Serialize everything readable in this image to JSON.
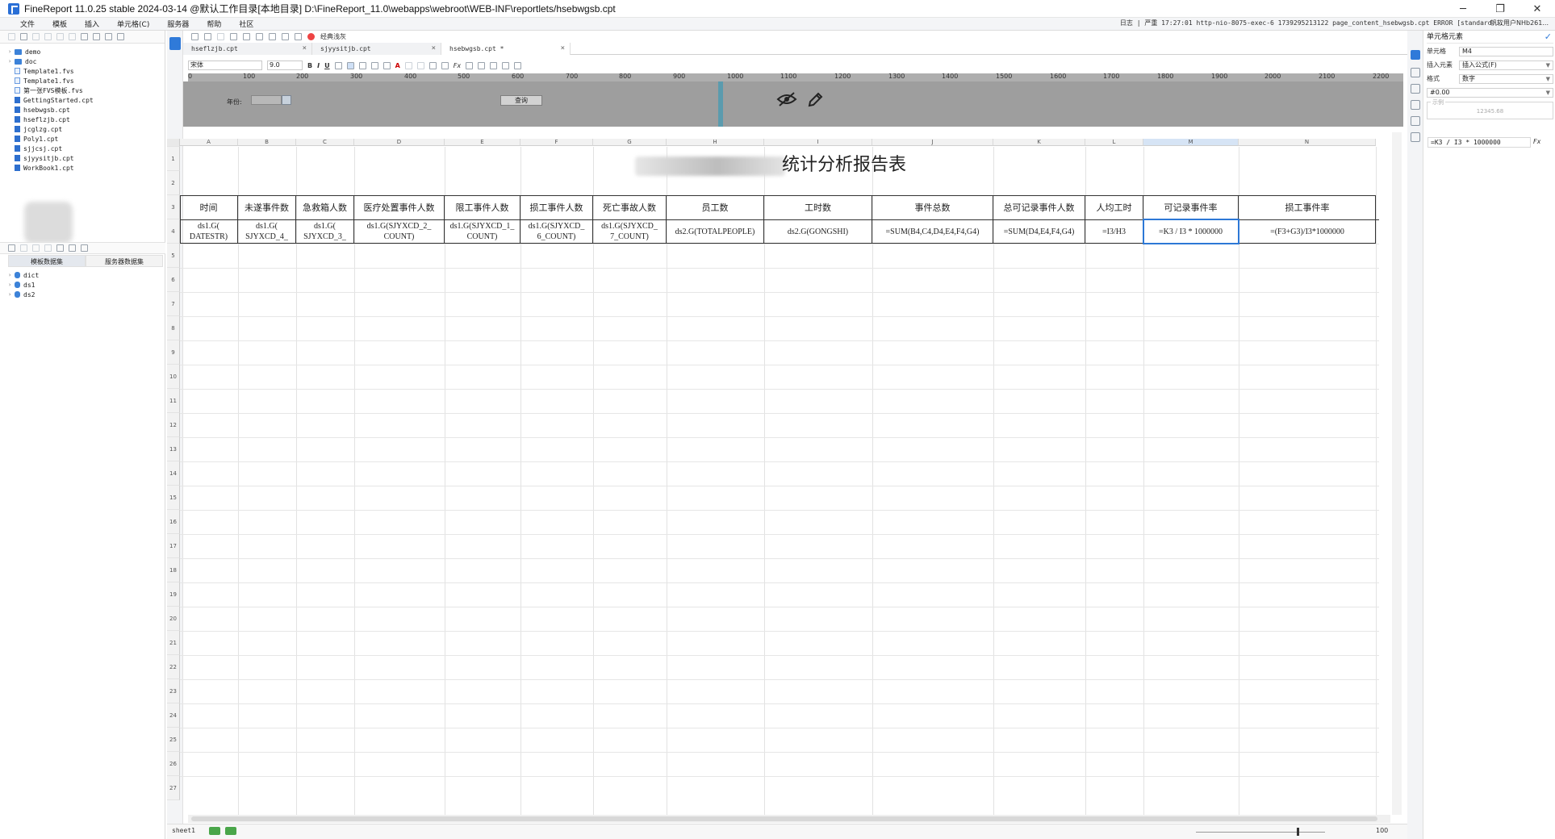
{
  "window": {
    "title": "FineReport 11.0.25 stable 2024-03-14 @默认工作目录[本地目录]    D:\\FineReport_11.0\\webapps\\webroot\\WEB-INF\\reportlets/hsebwgsb.cpt",
    "minimize": "─",
    "restore": "❐",
    "close": "✕"
  },
  "menu": {
    "items": [
      "文件",
      "模板",
      "插入",
      "单元格(C)",
      "服务器",
      "帮助",
      "社区"
    ],
    "log_text": "日志 | 严重 17:27:01 http-nio-8075-exec-6 1739295213122 page_content_hsebwgsb.cpt ERROR [standard...",
    "user": "帆软用户NHb261..."
  },
  "file_tree": [
    {
      "name": "demo",
      "type": "folder"
    },
    {
      "name": "doc",
      "type": "folder"
    },
    {
      "name": "Template1.fvs",
      "type": "file"
    },
    {
      "name": "Template1.fvs",
      "type": "file"
    },
    {
      "name": "第一张FVS模板.fvs",
      "type": "file"
    },
    {
      "name": "GettingStarted.cpt",
      "type": "cpt"
    },
    {
      "name": "hsebwgsb.cpt",
      "type": "cpt"
    },
    {
      "name": "hseflzjb.cpt",
      "type": "cpt"
    },
    {
      "name": "jcglzg.cpt",
      "type": "cpt"
    },
    {
      "name": "Poly1.cpt",
      "type": "cpt"
    },
    {
      "name": "sjjcsj.cpt",
      "type": "cpt"
    },
    {
      "name": "sjyysitjb.cpt",
      "type": "cpt"
    },
    {
      "name": "WorkBook1.cpt",
      "type": "cpt"
    }
  ],
  "datasets": {
    "tabs": [
      "模板数据集",
      "服务器数据集"
    ],
    "items": [
      "dict",
      "ds1",
      "ds2"
    ]
  },
  "editor": {
    "tabs": [
      {
        "label": "hseflzjb.cpt"
      },
      {
        "label": "sjyysitjb.cpt"
      },
      {
        "label": "hsebwgsb.cpt *"
      }
    ],
    "classic_view": "经典浅灰",
    "font_name": "宋体",
    "font_size": "9.0",
    "ruler_labels": [
      "0",
      "100",
      "200",
      "300",
      "400",
      "500",
      "600",
      "700",
      "800",
      "900",
      "1000",
      "1100",
      "1200",
      "1300",
      "1400",
      "1500",
      "1600",
      "1700",
      "1800",
      "1900",
      "2000",
      "2100",
      "2200"
    ]
  },
  "param_panel": {
    "year_label": "年份:",
    "query_label": "查询"
  },
  "grid": {
    "columns": [
      "A",
      "B",
      "C",
      "D",
      "E",
      "F",
      "G",
      "H",
      "I",
      "J",
      "K",
      "L",
      "M",
      "N"
    ],
    "rows": [
      "1",
      "2",
      "3",
      "4",
      "5",
      "6",
      "7",
      "8",
      "9",
      "10",
      "11",
      "12",
      "13",
      "14",
      "15",
      "16",
      "17",
      "18",
      "19",
      "20",
      "21",
      "22",
      "23",
      "24",
      "25",
      "26",
      "27"
    ],
    "title_text": "统计分析报告表",
    "headers": [
      "时间",
      "未遂事件数",
      "急救箱人数",
      "医疗处置事件人数",
      "限工事件人数",
      "损工事件人数",
      "死亡事故人数",
      "员工数",
      "工时数",
      "事件总数",
      "总可记录事件人数",
      "人均工时",
      "可记录事件率",
      "损工事件率"
    ],
    "formulas": [
      [
        "ds1.G(",
        "DATESTR)"
      ],
      [
        "ds1.G(",
        "SJYXCD_4_"
      ],
      [
        "ds1.G(",
        "SJYXCD_3_"
      ],
      [
        "ds1.G(SJYXCD_2_",
        "COUNT)"
      ],
      [
        "ds1.G(SJYXCD_1_",
        "COUNT)"
      ],
      [
        "ds1.G(SJYXCD_",
        "6_COUNT)"
      ],
      [
        "ds1.G(SJYXCD_",
        "7_COUNT)"
      ],
      [
        "ds2.G(TOTALPEOPLE)"
      ],
      [
        "ds2.G(GONGSHI)"
      ],
      [
        "=SUM(B4,C4,D4,E4,F4,G4)"
      ],
      [
        "=SUM(D4,E4,F4,G4)"
      ],
      [
        "=I3/H3"
      ],
      [
        "=K3 / I3 * 1000000"
      ],
      [
        "=(F3+G3)/I3*1000000"
      ]
    ]
  },
  "status": {
    "sheet": "sheet1",
    "zoom": "100"
  },
  "cell_panel": {
    "title": "单元格元素",
    "cell_label": "单元格",
    "cell_value": "M4",
    "insert_label": "插入元素",
    "insert_value": "插入公式(F)",
    "format_label": "格式",
    "format_value": "数字",
    "pattern_value": "#0.00",
    "sample_label": "示例",
    "sample_value": "12345.68",
    "formula_value": "=K3 / I3 * 1000000",
    "fx": "Fx"
  }
}
